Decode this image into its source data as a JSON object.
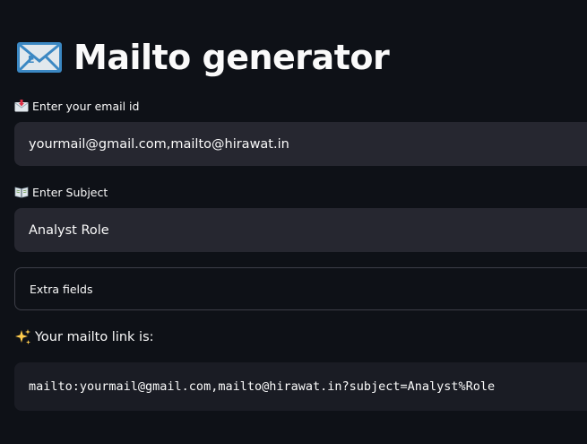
{
  "app": {
    "title": "Mailto generator",
    "title_icon": "e-mail-envelope-icon"
  },
  "email_field": {
    "label": "Enter your email id",
    "label_icon": "envelope-with-arrow-icon",
    "value": "yourmail@gmail.com,mailto@hirawat.in"
  },
  "subject_field": {
    "label": "Enter Subject",
    "label_icon": "open-book-icon",
    "value": "Analyst Role"
  },
  "extra_fields": {
    "label": "Extra fields"
  },
  "result": {
    "label": "Your mailto link is:",
    "label_icon": "sparkles-icon",
    "link": "mailto:yourmail@gmail.com,mailto@hirawat.in?subject=Analyst%Role"
  },
  "colors": {
    "background": "#0e1117",
    "input_background": "#262730",
    "code_background": "#1a1c24",
    "text": "#fafafa",
    "envelope_blue": "#3b88c3",
    "sparkle_yellow": "#ffcc4d"
  }
}
